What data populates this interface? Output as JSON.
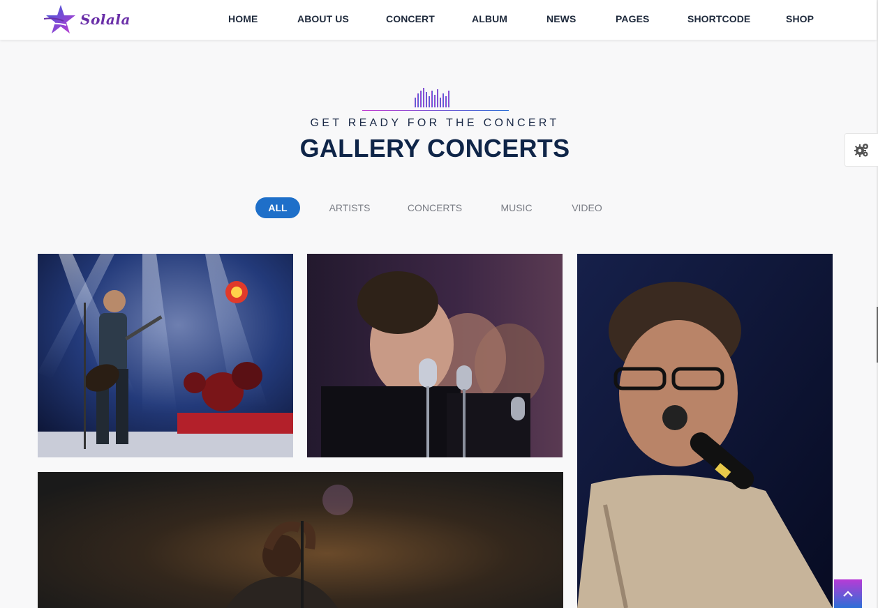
{
  "brand": {
    "name": "Solala"
  },
  "nav": {
    "items": [
      {
        "label": "HOME"
      },
      {
        "label": "ABOUT US"
      },
      {
        "label": "CONCERT"
      },
      {
        "label": "ALBUM"
      },
      {
        "label": "NEWS"
      },
      {
        "label": "PAGES"
      },
      {
        "label": "SHORTCODE"
      },
      {
        "label": "SHOP"
      }
    ]
  },
  "section": {
    "icon": "equalizer-icon",
    "subtitle": "GET READY FOR THE CONCERT",
    "title": "GALLERY CONCERTS"
  },
  "filters": {
    "items": [
      {
        "label": "ALL",
        "active": true
      },
      {
        "label": "ARTISTS",
        "active": false
      },
      {
        "label": "CONCERTS",
        "active": false
      },
      {
        "label": "MUSIC",
        "active": false
      },
      {
        "label": "VIDEO",
        "active": false
      }
    ]
  },
  "gallery": {
    "images": [
      {
        "subject": "rock guitarist singing on stage with drum kit and spotlights"
      },
      {
        "subject": "female backing singers at vintage microphones"
      },
      {
        "subject": "young man with glasses singing into microphone"
      },
      {
        "subject": "singer holding microphone stand under warm stage light"
      }
    ]
  },
  "widgets": {
    "settings_icon": "gears-icon",
    "back_to_top_icon": "chevron-up-icon"
  },
  "colors": {
    "accent": "#1e6fc9",
    "title": "#0f2548",
    "brand": "#6a2fa8",
    "gradient_top": "#b73bd6",
    "gradient_bottom": "#2c6fd6"
  }
}
